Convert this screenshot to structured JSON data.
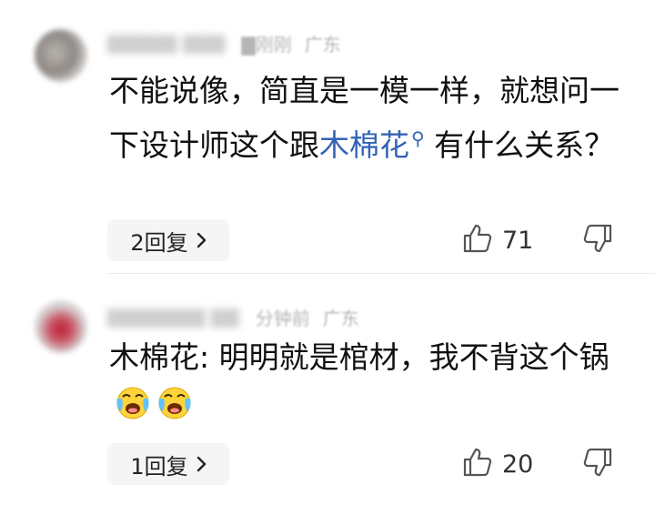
{
  "comments": [
    {
      "username": "▇▇▇▇▇ ▇▇▇",
      "time": "▇刚刚",
      "region": "广东",
      "text_before": "不能说像，简直是一模一样，就想问一下设计师这个跟",
      "link_text": "木棉花",
      "text_after": " 有什么关系？",
      "reply_label": "2回复",
      "likes": "71",
      "colors": {
        "link": "#3363b5"
      },
      "icons": [
        "search-icon",
        "chevron-right-icon",
        "thumbs-up-icon",
        "thumbs-down-icon"
      ]
    },
    {
      "username": "▇▇▇▇▇▇▇ ▇▇",
      "time": "分钟前",
      "region": "广东",
      "text": "木棉花: 明明就是棺材，我不背这个锅",
      "emojis": [
        "crying-laughing-emoji",
        "crying-laughing-emoji"
      ],
      "reply_label": "1回复",
      "likes": "20"
    }
  ]
}
